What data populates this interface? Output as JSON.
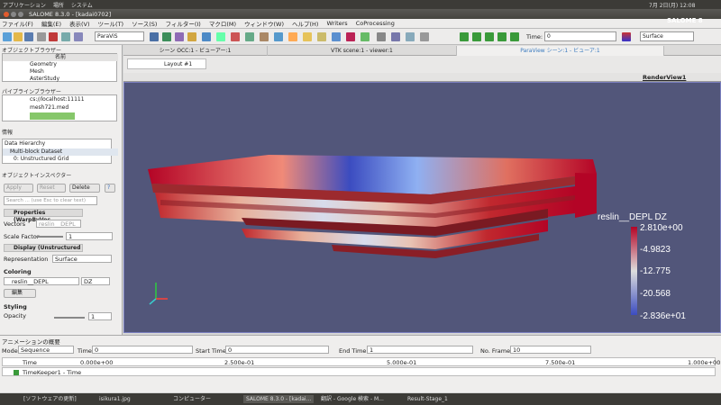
{
  "system_panel": {
    "items": [
      "アプリケーション",
      "場所",
      "システム"
    ],
    "clock": "7月 2日(月) 12:08"
  },
  "window_title": "SALOME 8.3.0 - [kadai0702]",
  "menu": [
    "ファイル(F)",
    "編集(E)",
    "表示(V)",
    "ツール(T)",
    "ソース(S)",
    "フィルター(I)",
    "マクロ(M)",
    "ウィンドウ(W)",
    "ヘルプ(H)",
    "Writers",
    "CoProcessing"
  ],
  "toolbar": {
    "module": "ParaViS",
    "time_label": "Time:",
    "time_value": "0",
    "representation": "Surface",
    "brand": "SALOME 8"
  },
  "object_browser": {
    "title": "オブジェクトブラウザー",
    "column": "名前",
    "items": [
      "Geometry",
      "Mesh",
      "AsterStudy"
    ]
  },
  "pipeline_browser": {
    "title": "パイプラインブラウザー",
    "items": [
      "cs://localhost:11111",
      "mesh721.med",
      "WarpByVector1"
    ]
  },
  "info": {
    "title": "情報",
    "items": [
      "Data Hierarchy",
      "Multi-block Dataset",
      "0: Unstructured Grid"
    ]
  },
  "inspector": {
    "title": "オブジェクトインスペクター",
    "apply": "Apply",
    "reset": "Reset",
    "delete": "Delete",
    "help": "?",
    "search_placeholder": "Search ... (use Esc to clear text)",
    "properties_header": "Properties (WarpByVec",
    "vectors_label": "Vectors",
    "vectors_value": "reslin__DEPL",
    "scale_label": "Scale Factor",
    "scale_value": "1",
    "display_header": "Display (Unstructured",
    "representation_label": "Representation",
    "representation_value": "Surface",
    "coloring_label": "Coloring",
    "coloring_array": "reslin__DEPL",
    "coloring_comp": "DZ",
    "edit_btn": "編集",
    "styling_label": "Styling",
    "opacity_label": "Opacity",
    "opacity_value": "1"
  },
  "view_tabs": [
    "シーン OCC:1 - ビューアー:1",
    "VTK scene:1 - viewer:1",
    "ParaView シーン:1 - ビューア:1"
  ],
  "layout_tab": "Layout #1",
  "render_view": "RenderView1",
  "legend": {
    "title": "reslin__DEPL DZ",
    "ticks": [
      "2.810e+00",
      "-4.9823",
      "-12.775",
      "-20.568",
      "-2.836e+01"
    ]
  },
  "animation": {
    "title": "アニメーションの概要",
    "mode_label": "Mode:",
    "mode_value": "Sequence",
    "time_label": "Time:",
    "time_value": "0",
    "start_label": "Start Time:",
    "start_value": "0",
    "end_label": "End Time:",
    "end_value": "1",
    "frames_label": "No. Frames:",
    "frames_value": "10",
    "col_time": "Time",
    "ticks": [
      "0.000e+00",
      "2.500e-01",
      "5.000e-01",
      "7.500e-01",
      "1.000e+00"
    ],
    "row": "TimeKeeper1 - Time"
  },
  "taskbar": [
    "[ソフトウェアの更新]",
    "isikura1.jpg",
    "コンピューター",
    "SALOME 8.3.0 - [kadai...",
    "翻訳 - Google 検索 - M...",
    "Result-Stage_1"
  ],
  "colors": {
    "viewport_bg": "#52567a",
    "accent_blue": "#3b4cc0",
    "accent_red": "#b40426"
  }
}
